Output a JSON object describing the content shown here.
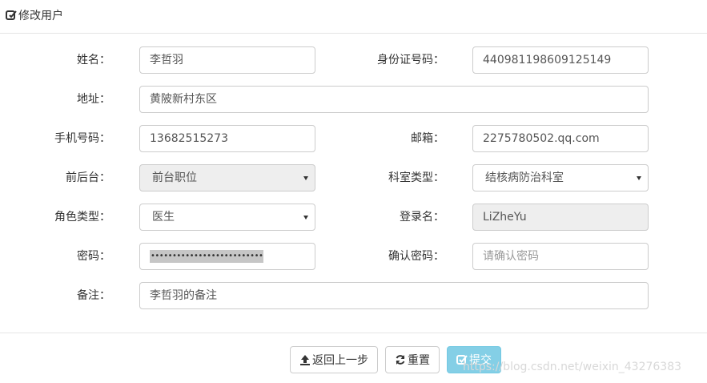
{
  "header": {
    "title": "修改用户",
    "icon": "edit-square-icon"
  },
  "form": {
    "name": {
      "label": "姓名：",
      "value": "李哲羽"
    },
    "id_card": {
      "label": "身份证号码：",
      "value": "440981198609125149"
    },
    "address": {
      "label": "地址：",
      "value": "黄陂新村东区"
    },
    "phone": {
      "label": "手机号码：",
      "value": "13682515273"
    },
    "email": {
      "label": "邮箱：",
      "value": "2275780502.qq.com"
    },
    "front_back": {
      "label": "前后台：",
      "value": "前台职位"
    },
    "dept_type": {
      "label": "科室类型：",
      "value": "结核病防治科室"
    },
    "role_type": {
      "label": "角色类型：",
      "value": "医生"
    },
    "login_name": {
      "label": "登录名：",
      "value": "LiZheYu"
    },
    "password": {
      "label": "密码：",
      "mask": "••••••••••••••••••••••••••"
    },
    "confirm_password": {
      "label": "确认密码：",
      "placeholder": "请确认密码"
    },
    "remark": {
      "label": "备注：",
      "value": "李哲羽的备注"
    }
  },
  "buttons": {
    "back": {
      "label": "返回上一步",
      "icon": "upload-icon"
    },
    "reset": {
      "label": "重置",
      "icon": "refresh-icon"
    },
    "submit": {
      "label": "提交",
      "icon": "check-square-icon",
      "color": "#5bc0de"
    }
  },
  "watermark": "https://blog.csdn.net/weixin_43276383"
}
